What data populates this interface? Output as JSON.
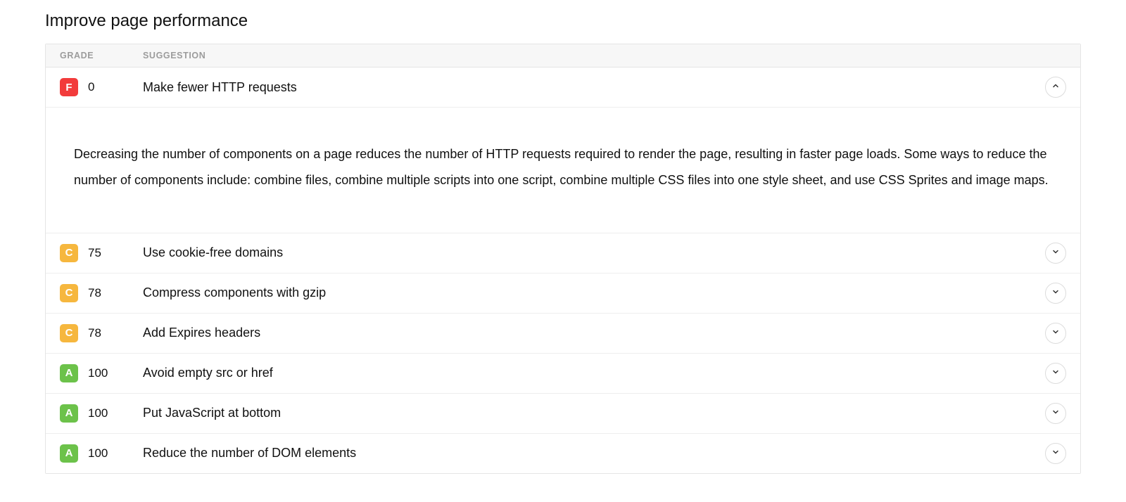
{
  "title": "Improve page performance",
  "columns": {
    "grade": "GRADE",
    "suggestion": "SUGGESTION"
  },
  "rows": [
    {
      "grade": "F",
      "score": "0",
      "suggestion": "Make fewer HTTP requests",
      "expanded": true,
      "detail": "Decreasing the number of components on a page reduces the number of HTTP requests required to render the page, resulting in faster page loads. Some ways to reduce the number of components include: combine files, combine multiple scripts into one script, combine multiple CSS files into one style sheet, and use CSS Sprites and image maps."
    },
    {
      "grade": "C",
      "score": "75",
      "suggestion": "Use cookie-free domains",
      "expanded": false
    },
    {
      "grade": "C",
      "score": "78",
      "suggestion": "Compress components with gzip",
      "expanded": false
    },
    {
      "grade": "C",
      "score": "78",
      "suggestion": "Add Expires headers",
      "expanded": false
    },
    {
      "grade": "A",
      "score": "100",
      "suggestion": "Avoid empty src or href",
      "expanded": false
    },
    {
      "grade": "A",
      "score": "100",
      "suggestion": "Put JavaScript at bottom",
      "expanded": false
    },
    {
      "grade": "A",
      "score": "100",
      "suggestion": "Reduce the number of DOM elements",
      "expanded": false
    }
  ]
}
